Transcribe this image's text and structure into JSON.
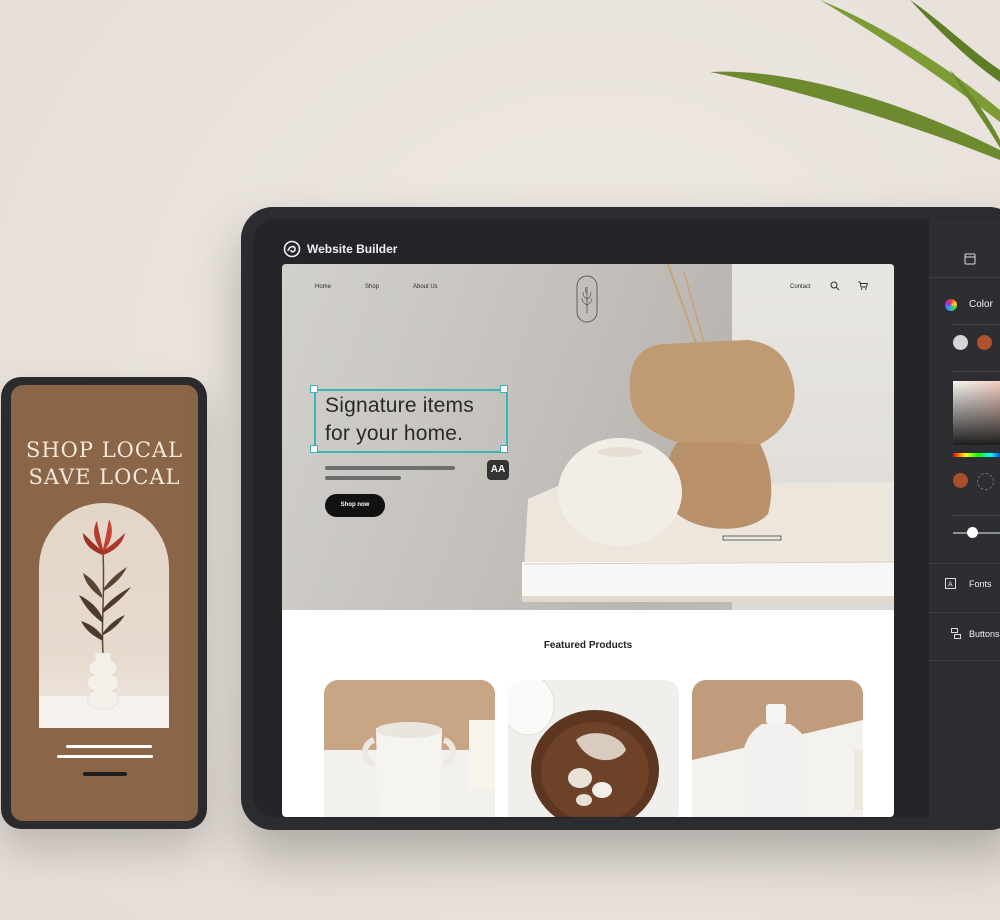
{
  "phone": {
    "headline_line1": "SHOP LOCAL",
    "headline_line2": "SAVE LOCAL"
  },
  "app": {
    "title": "Website Builder"
  },
  "site": {
    "nav": {
      "home": "Home",
      "shop": "Shop",
      "about": "About Us",
      "contact": "Contact"
    },
    "hero": {
      "headline_line1": "Signature items",
      "headline_line2": "for your home.",
      "cta": "Shop now",
      "text_style_button": "AA"
    },
    "featured_title": "Featured Products"
  },
  "panel": {
    "color_label": "Color",
    "fonts_label": "Fonts",
    "buttons_label": "Buttons",
    "swatches": [
      "#d5d5d5",
      "#b0502c",
      "#d8cfc7"
    ],
    "picked_color": "#a84e2a"
  },
  "colors": {
    "accent_selection": "#3bb7b3",
    "phone_background": "#8a6547",
    "app_background": "#232528"
  }
}
